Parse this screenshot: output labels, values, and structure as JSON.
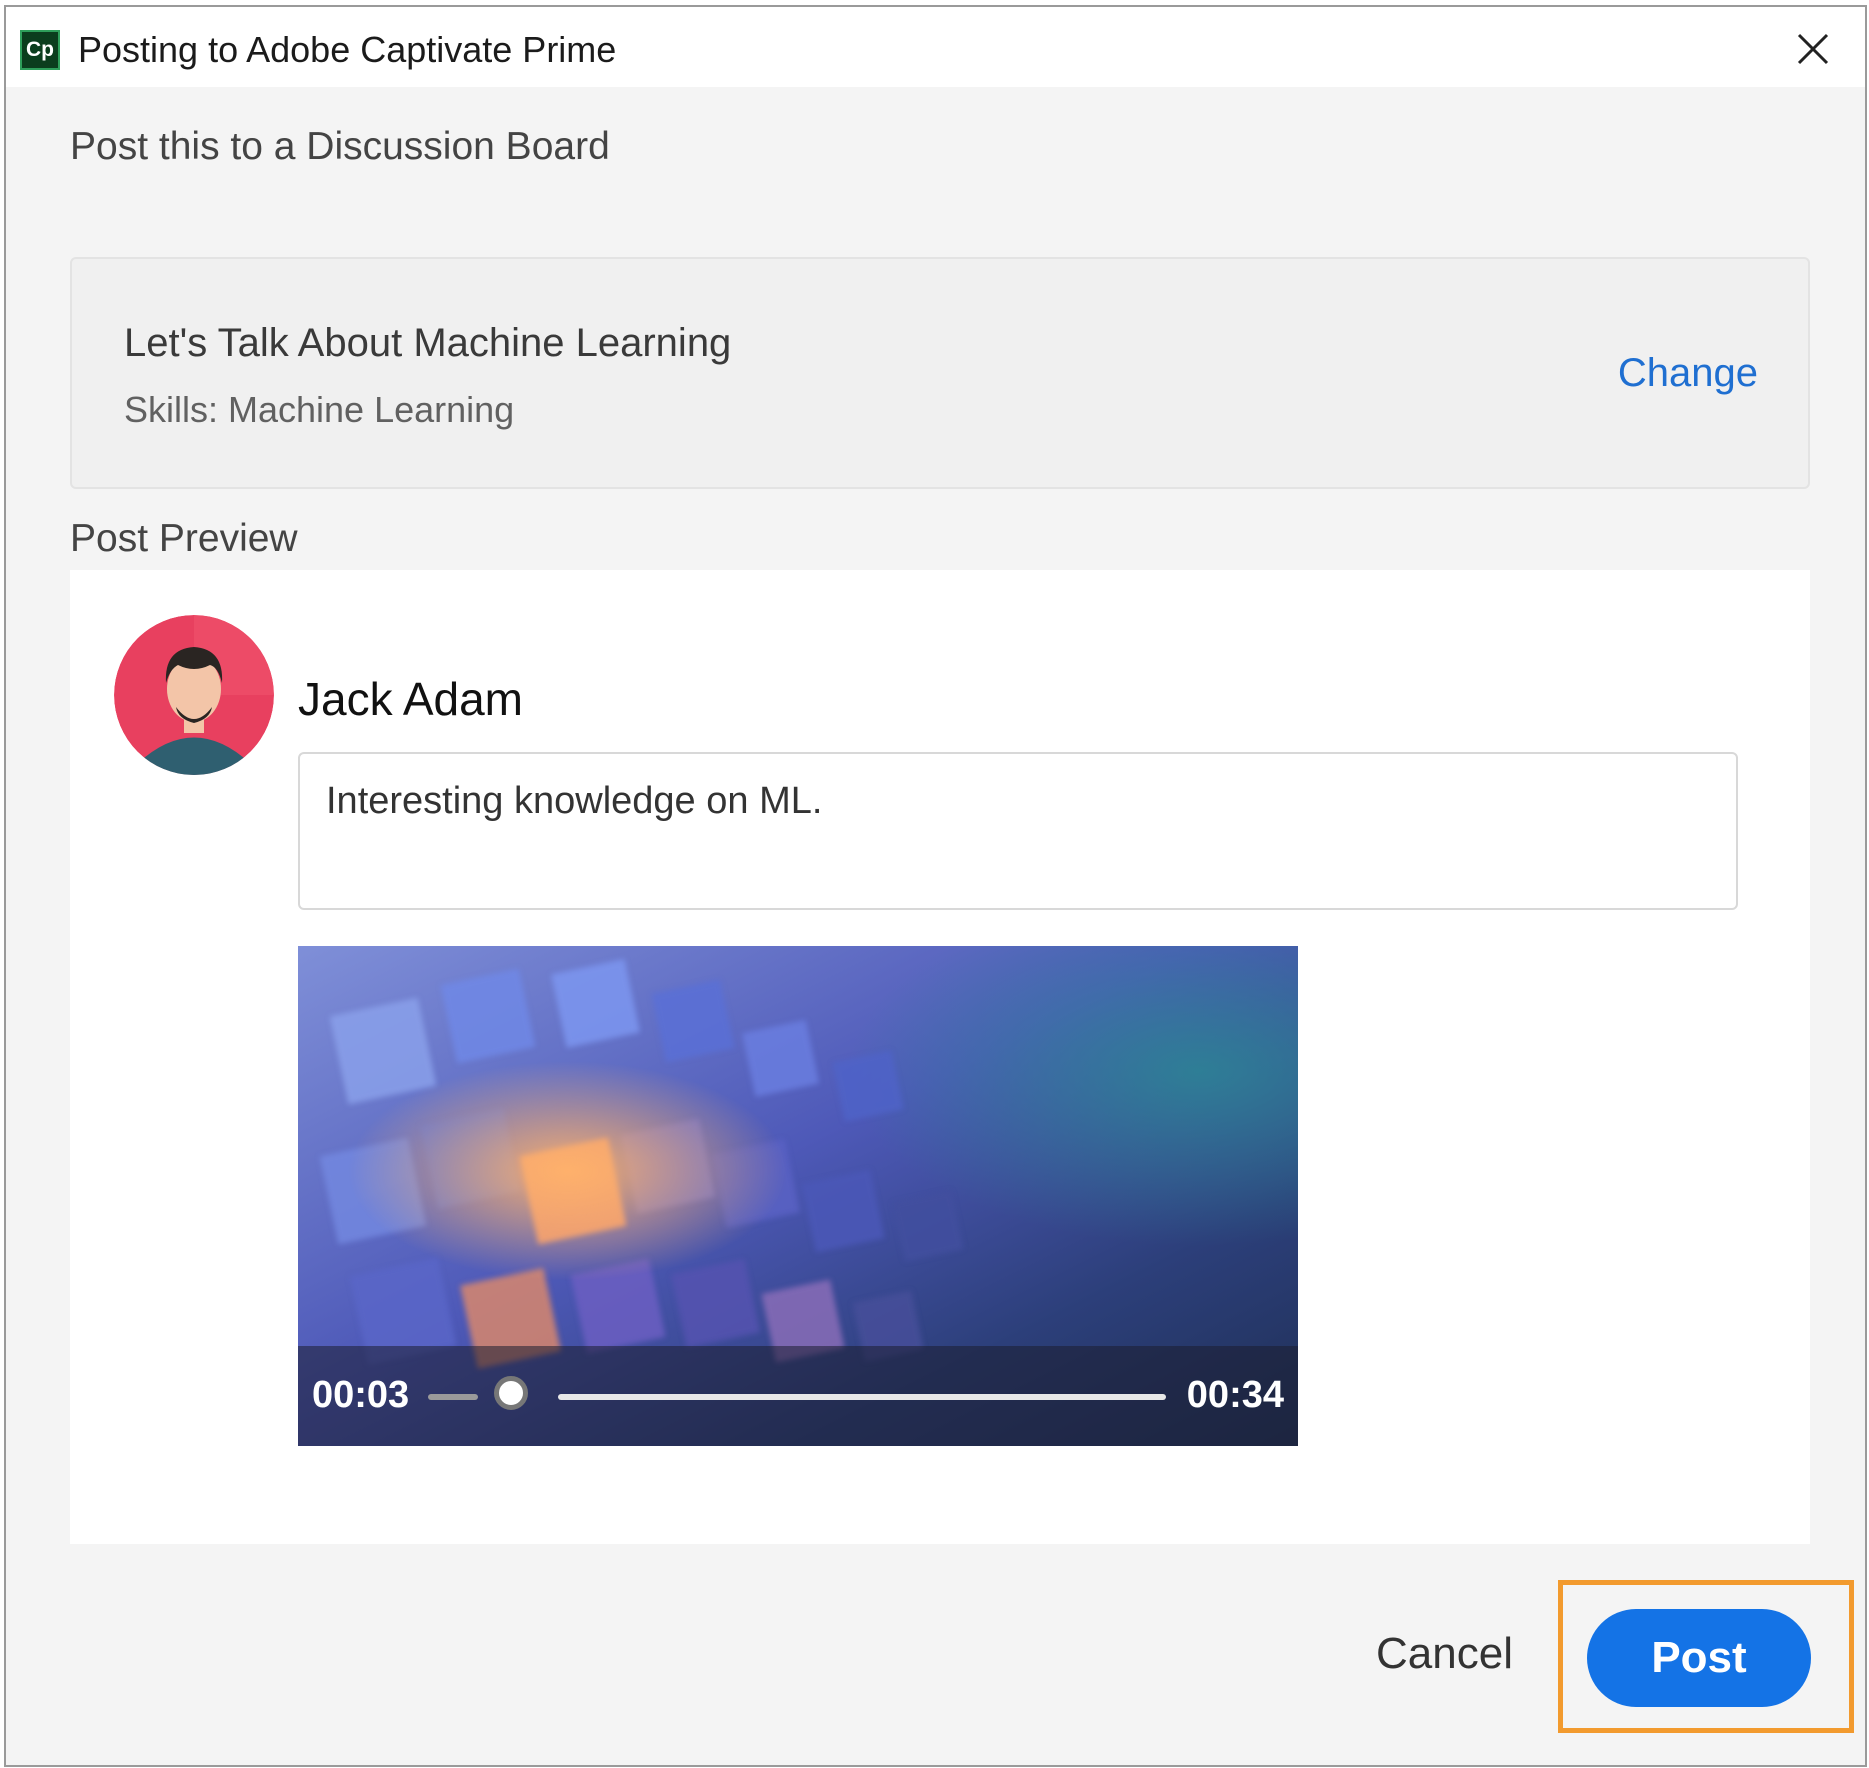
{
  "window": {
    "title": "Posting to Adobe Captivate Prime",
    "app_icon_label": "Cp"
  },
  "board_section": {
    "heading": "Post this to a Discussion Board",
    "board_title": "Let's Talk About Machine Learning",
    "board_skills": "Skills: Machine Learning",
    "change_label": "Change"
  },
  "preview": {
    "heading": "Post Preview",
    "user_name": "Jack Adam",
    "comment": "Interesting knowledge on ML.",
    "video": {
      "current_time": "00:03",
      "total_time": "00:34",
      "progress_fraction": 0.09
    }
  },
  "actions": {
    "cancel_label": "Cancel",
    "post_label": "Post"
  },
  "colors": {
    "accent_blue": "#1473e6",
    "link_blue": "#1f6fd1",
    "highlight_orange": "#f29a2e",
    "avatar_bg": "#e8405f"
  },
  "icons": {
    "app": "captivate-app-icon",
    "close": "close-icon"
  }
}
